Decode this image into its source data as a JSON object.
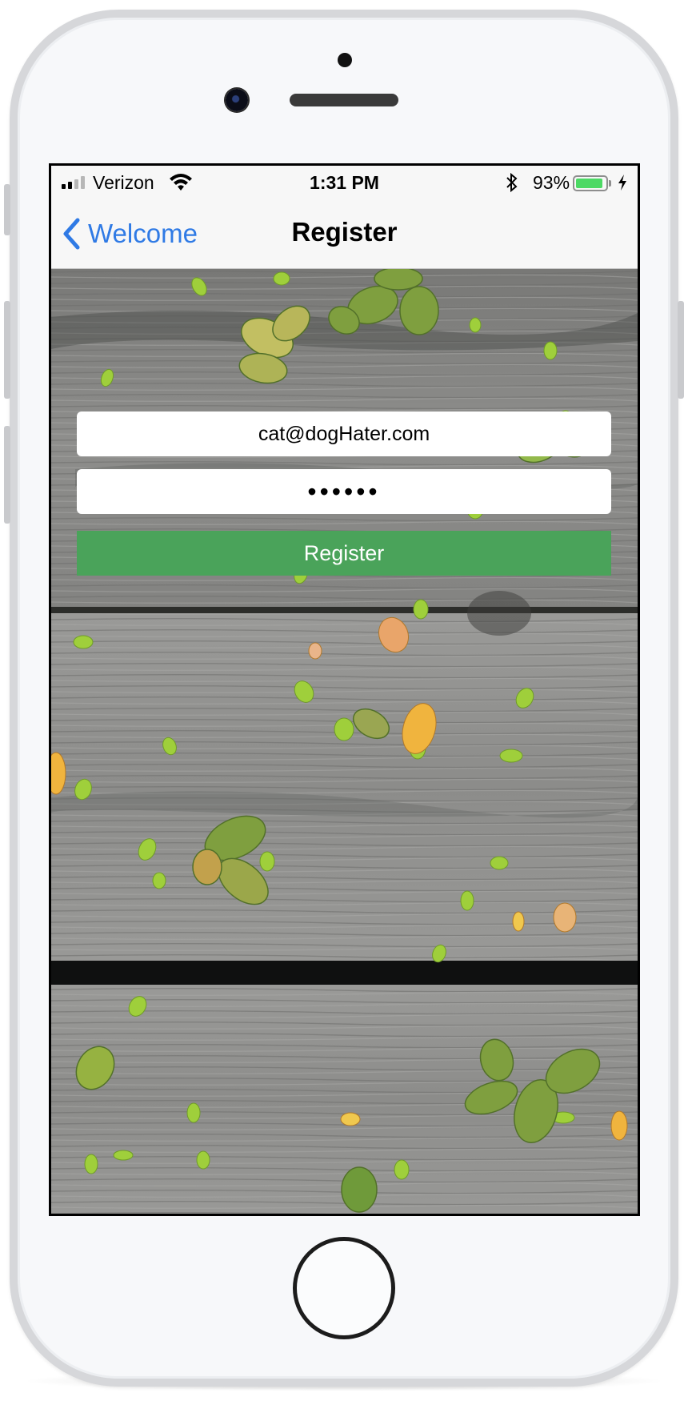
{
  "status_bar": {
    "carrier": "Verizon",
    "time": "1:31 PM",
    "battery_percent": "93%",
    "battery_level": 0.93,
    "signal_bars_filled": 2,
    "signal_bars_total": 4,
    "icons": [
      "signal-icon",
      "wifi-icon",
      "bluetooth-icon",
      "battery-icon",
      "charging-icon"
    ]
  },
  "nav_bar": {
    "back_label": "Welcome",
    "title": "Register"
  },
  "form": {
    "email_value": "cat@dogHater.com",
    "password_masked": "••••••",
    "submit_label": "Register"
  },
  "colors": {
    "ios_blue": "#2f7ae5",
    "button_green": "#4aa35a",
    "battery_green": "#4cd964"
  }
}
